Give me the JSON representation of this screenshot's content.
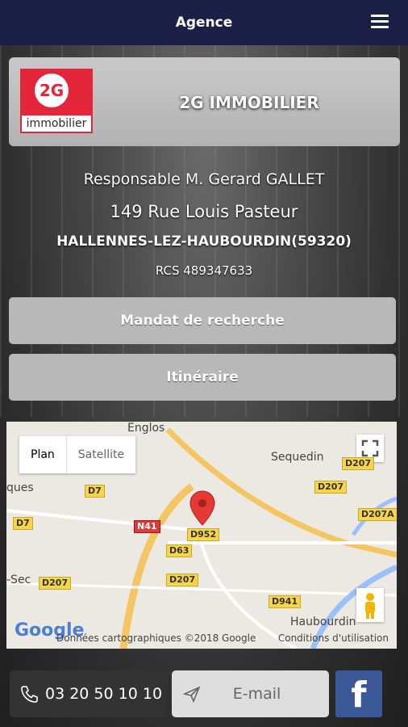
{
  "header": {
    "title": "Agence",
    "menu_icon": "hamburger-menu-icon"
  },
  "agency": {
    "name": "2G IMMOBILIER",
    "logo": {
      "mark": "2G",
      "label": "immobilier",
      "color": "#e4263b"
    },
    "manager": "Responsable M. Gerard GALLET",
    "street": "149 Rue Louis Pasteur",
    "city": "HALLENNES-LEZ-HAUBOURDIN(59320)",
    "rcs": "RCS 489347633"
  },
  "buttons": {
    "search_mandate": "Mandat de recherche",
    "itinerary": "Itinéraire"
  },
  "map": {
    "tabs": [
      {
        "label": "Plan",
        "active": true
      },
      {
        "label": "Satellite",
        "active": false
      }
    ],
    "places": [
      "Englos",
      "Sequedin",
      "ques",
      "Haubourdin",
      "-Sec"
    ],
    "roads": [
      "D207",
      "D7",
      "D207",
      "D207A",
      "D7",
      "N41",
      "D952",
      "D63",
      "D207",
      "D207",
      "D941"
    ],
    "google": "Google",
    "copyright": "Données cartographiques ©2018 Google",
    "terms": "Conditions d'utilisation",
    "pin_color": "#e53935"
  },
  "contact": {
    "phone": "03 20 50 10 10",
    "email_label": "E-mail",
    "facebook": "f"
  },
  "colors": {
    "header_bg": "#1c2046",
    "facebook": "#3b5998"
  }
}
